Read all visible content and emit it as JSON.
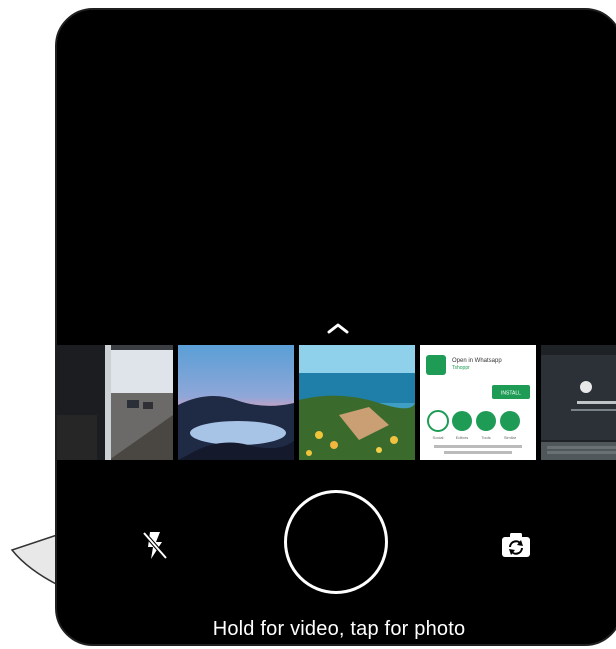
{
  "camera": {
    "gallery_chevron": "chevron-up-icon",
    "recent_media": [
      {
        "name": "thumb-window-street"
      },
      {
        "name": "thumb-lake-sunset"
      },
      {
        "name": "thumb-seaside-flowers"
      },
      {
        "name": "thumb-whatsapp-store"
      },
      {
        "name": "thumb-laptop"
      }
    ],
    "controls": {
      "flash_icon": "flash-off-icon",
      "shutter": "shutter-button",
      "flip_icon": "switch-camera-icon"
    },
    "hint": "Hold for video, tap for photo"
  },
  "store_card": {
    "title": "Open in Whatsapp",
    "subtitle": "Tshoppr",
    "install": "INSTALL",
    "chips": [
      "Social",
      "Editors",
      "Tools",
      "Similar"
    ]
  },
  "colors": {
    "background": "#000000",
    "text": "#ffffff",
    "accent": "#1e9c55"
  }
}
